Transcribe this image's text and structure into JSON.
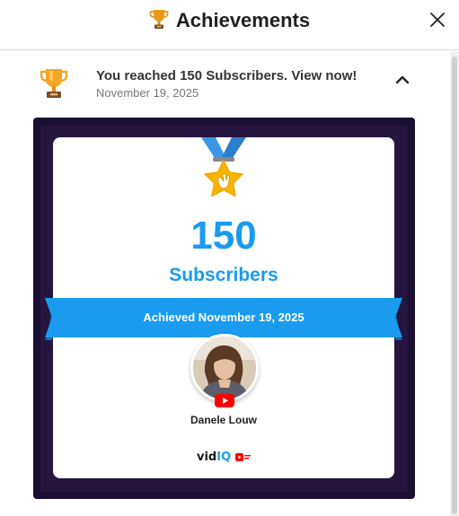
{
  "header": {
    "title": "Achievements",
    "trophy_icon": "trophy-icon",
    "close_icon": "close-icon"
  },
  "notification": {
    "icon": "trophy-icon",
    "title": "You reached 150 Subscribers. View now!",
    "date": "November 19, 2025",
    "toggle_icon": "chevron-up-icon"
  },
  "card": {
    "count": "150",
    "unit": "Subscribers",
    "ribbon_text": "Achieved November 19, 2025",
    "channel_name": "Danele Louw",
    "brand": {
      "prefix": "vid",
      "suffix": "IQ"
    },
    "colors": {
      "accent": "#1a9bf0",
      "frame": "#1b0f33",
      "medal_star": "#f7b500",
      "medal_ribbon": "#3b97e3",
      "youtube_red": "#ff0000"
    }
  }
}
